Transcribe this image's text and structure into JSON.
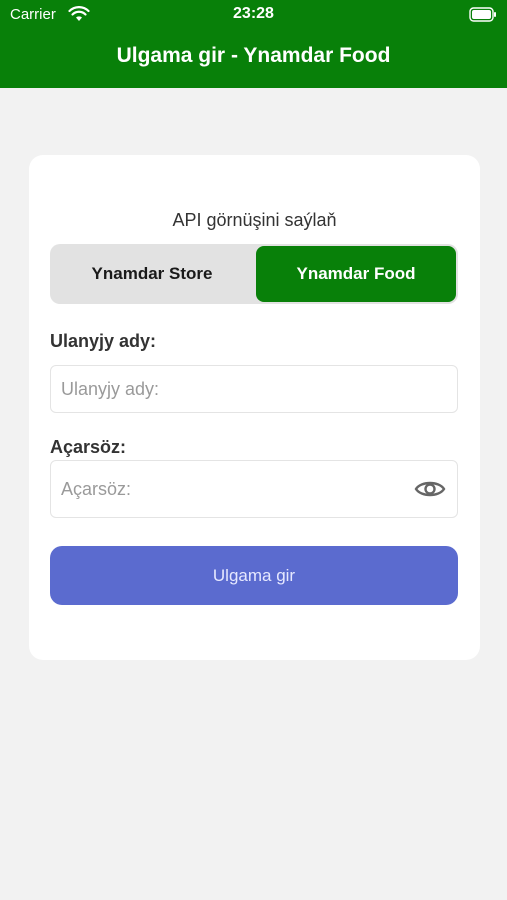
{
  "status_bar": {
    "carrier": "Carrier",
    "time": "23:28",
    "icons": [
      "wifi-icon",
      "battery-icon"
    ]
  },
  "header": {
    "title": "Ulgama gir - Ynamdar Food",
    "color": "#088009"
  },
  "form": {
    "api_label": "API görnüşini saýlaň",
    "segments": [
      {
        "label": "Ynamdar Store",
        "selected": false
      },
      {
        "label": "Ynamdar Food",
        "selected": true
      }
    ],
    "username": {
      "label": "Ulanyjy ady:",
      "placeholder": "Ulanyjy ady:",
      "value": ""
    },
    "password": {
      "label": "Açarsöz:",
      "placeholder": "Açarsöz:",
      "value": "",
      "toggle_icon": "eye-icon"
    },
    "submit_label": "Ulgama gir",
    "submit_color": "#5b6bcf"
  }
}
